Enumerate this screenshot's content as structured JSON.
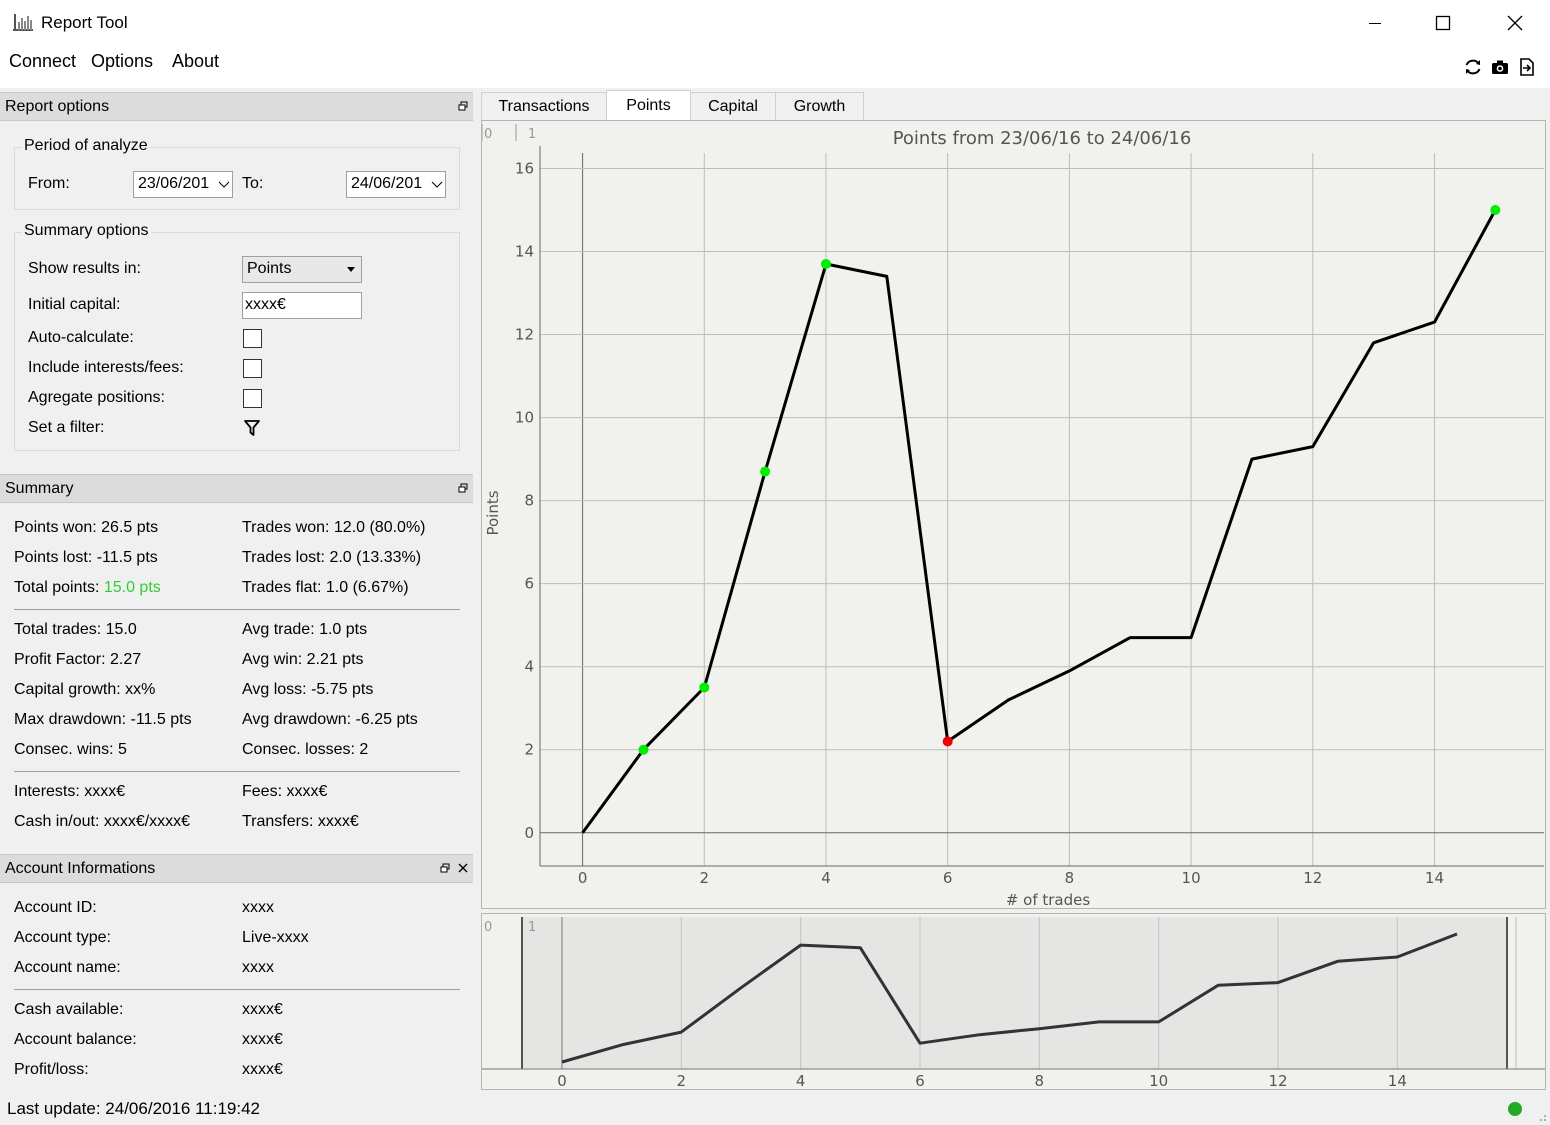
{
  "window": {
    "title": "Report Tool",
    "minimize_icon": "minimize-icon",
    "maximize_icon": "maximize-icon",
    "close_icon": "close-icon"
  },
  "menu": {
    "items": [
      "Connect",
      "Options",
      "About"
    ]
  },
  "toolbar": {
    "icons": [
      "refresh-icon",
      "camera-icon",
      "export-icon"
    ]
  },
  "report_options": {
    "title": "Report options",
    "period": {
      "title": "Period of analyze",
      "from_label": "From:",
      "from_value": "23/06/201",
      "to_label": "To:",
      "to_value": "24/06/201"
    },
    "summary_options": {
      "title": "Summary options",
      "show_results_label": "Show results in:",
      "show_results_value": "Points",
      "initial_capital_label": "Initial capital:",
      "initial_capital_value": "xxxx€",
      "auto_calculate_label": "Auto-calculate:",
      "auto_calculate_checked": false,
      "include_interests_label": "Include interests/fees:",
      "include_interests_checked": false,
      "aggregate_label": "Agregate positions:",
      "aggregate_checked": false,
      "filter_label": "Set a filter:"
    }
  },
  "summary": {
    "title": "Summary",
    "points_won": "Points won: 26.5 pts",
    "trades_won": "Trades won: 12.0 (80.0%)",
    "points_lost": "Points lost: -11.5 pts",
    "trades_lost": "Trades lost: 2.0 (13.33%)",
    "total_points_label": "Total points: ",
    "total_points_value": "15.0 pts",
    "trades_flat": "Trades flat: 1.0 (6.67%)",
    "total_trades": "Total trades: 15.0",
    "avg_trade": "Avg trade: 1.0 pts",
    "profit_factor": "Profit Factor: 2.27",
    "avg_win": "Avg win: 2.21 pts",
    "capital_growth": "Capital growth: xx%",
    "avg_loss": "Avg loss: -5.75 pts",
    "max_drawdown": "Max drawdown: -11.5 pts",
    "avg_drawdown": "Avg drawdown: -6.25 pts",
    "consec_wins": "Consec. wins: 5",
    "consec_losses": "Consec. losses: 2",
    "interests": "Interests: xxxx€",
    "fees": "Fees: xxxx€",
    "cash_in_out": "Cash in/out: xxxx€/xxxx€",
    "transfers": "Transfers: xxxx€",
    "positive_color": "#33cc33"
  },
  "account": {
    "title": "Account Informations",
    "id_label": "Account ID:",
    "id_value": "xxxx",
    "type_label": "Account type:",
    "type_value": "Live-xxxx",
    "name_label": "Account name:",
    "name_value": "xxxx",
    "cash_label": "Cash available:",
    "cash_value": "xxxx€",
    "balance_label": "Account balance:",
    "balance_value": "xxxx€",
    "pl_label": "Profit/loss:",
    "pl_value": "xxxx€"
  },
  "status": {
    "last_update": "Last update: 24/06/2016 11:19:42",
    "connection_color": "#22aa22"
  },
  "tabs": [
    "Transactions",
    "Points",
    "Capital",
    "Growth"
  ],
  "active_tab": "Points",
  "chart_data": {
    "type": "line",
    "title": "Points from 23/06/16 to 24/06/16",
    "xlabel": "# of trades",
    "ylabel": "Points",
    "x": [
      0,
      1,
      2,
      3,
      4,
      5,
      6,
      7,
      8,
      9,
      10,
      11,
      12,
      13,
      14,
      15
    ],
    "y": [
      0,
      2.0,
      3.5,
      8.7,
      13.7,
      13.4,
      2.2,
      3.2,
      3.9,
      4.7,
      4.7,
      9.0,
      9.3,
      11.8,
      12.3,
      15.0
    ],
    "xlim": [
      -0.7,
      15.8
    ],
    "ylim": [
      -0.8,
      16.3
    ],
    "xticks": [
      0,
      2,
      4,
      6,
      8,
      10,
      12,
      14
    ],
    "yticks": [
      0,
      2,
      4,
      6,
      8,
      10,
      12,
      14,
      16
    ],
    "markers": [
      {
        "x": 1,
        "y": 2.0,
        "color": "#00ee00"
      },
      {
        "x": 2,
        "y": 3.5,
        "color": "#00ee00"
      },
      {
        "x": 3,
        "y": 8.7,
        "color": "#00ee00"
      },
      {
        "x": 4,
        "y": 13.7,
        "color": "#00ee00"
      },
      {
        "x": 6,
        "y": 2.2,
        "color": "#ee0000"
      },
      {
        "x": 15,
        "y": 15.0,
        "color": "#00ee00"
      }
    ],
    "corner_labels": [
      "0",
      "1"
    ],
    "grid": true,
    "line_color": "#000000",
    "navigator": {
      "xticks": [
        0,
        2,
        4,
        6,
        8,
        10,
        12,
        14
      ],
      "xlim": [
        -0.7,
        15.8
      ],
      "line_color": "#333333"
    }
  }
}
